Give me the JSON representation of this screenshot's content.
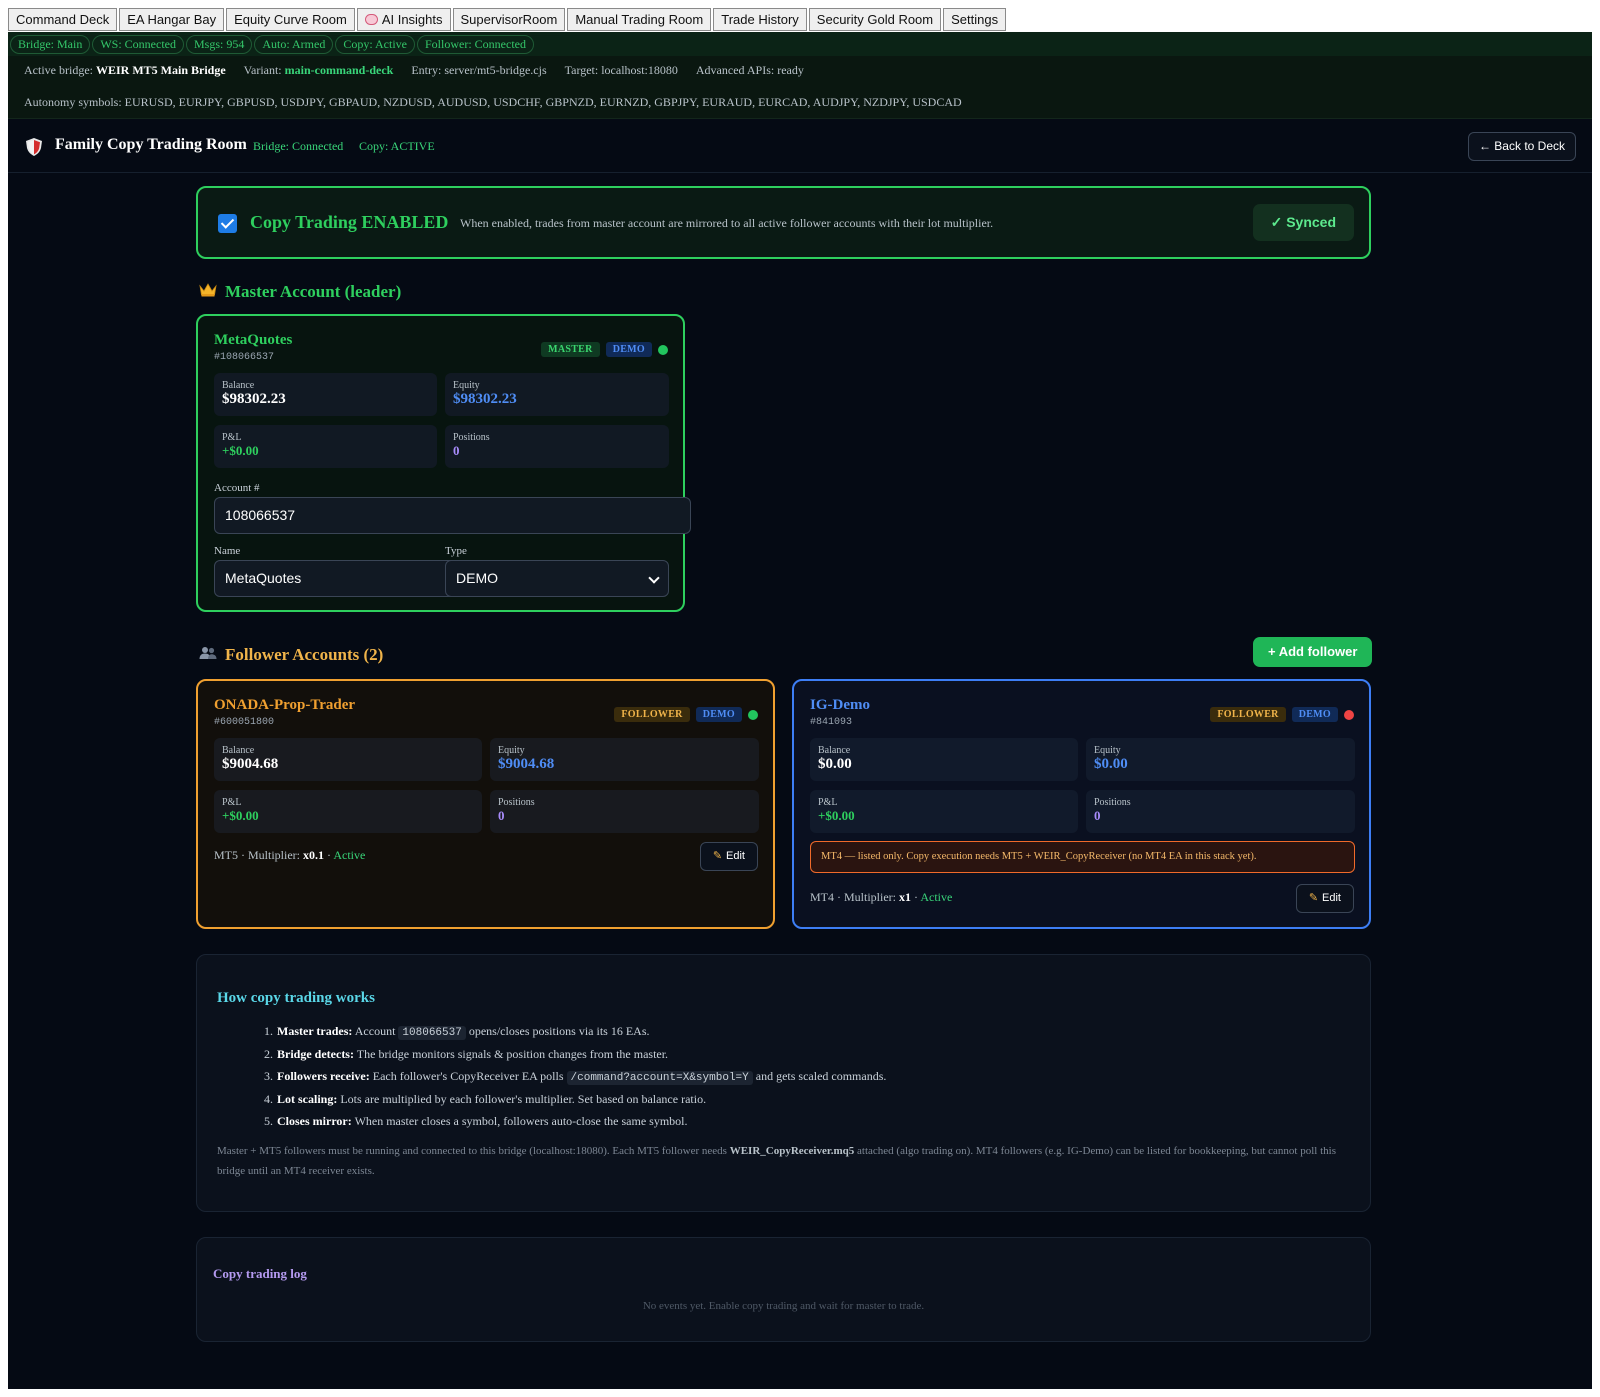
{
  "tabs": [
    {
      "label": "Command Deck"
    },
    {
      "label": "EA Hangar Bay"
    },
    {
      "label": "Equity Curve Room"
    },
    {
      "label": "AI Insights"
    },
    {
      "label": "SupervisorRoom"
    },
    {
      "label": "Manual Trading Room"
    },
    {
      "label": "Trade History"
    },
    {
      "label": "Security Gold Room"
    },
    {
      "label": "Settings"
    }
  ],
  "status_pills": [
    {
      "label": "Bridge: Main"
    },
    {
      "label": "WS: Connected"
    },
    {
      "label": "Msgs: 954"
    },
    {
      "label": "Auto: Armed"
    },
    {
      "label": "Copy: Active"
    },
    {
      "label": "Follower: Connected"
    }
  ],
  "info": {
    "bridge_label": "Active bridge:",
    "bridge_value": "WEIR MT5 Main Bridge",
    "variant_label": "Variant:",
    "variant_value": "main-command-deck",
    "entry": "Entry: server/mt5-bridge.cjs",
    "target": "Target: localhost:18080",
    "apis": "Advanced APIs: ready",
    "symbols": "Autonomy symbols: EURUSD, EURJPY, GBPUSD, USDJPY, GBPAUD, NZDUSD, AUDUSD, USDCHF, GBPNZD, EURNZD, GBPJPY, EURAUD, EURCAD, AUDJPY, NZDJPY, USDCAD"
  },
  "header": {
    "title": "Family Copy Trading Room",
    "bridge_status": "Bridge: Connected",
    "copy_status": "Copy: ACTIVE",
    "back_label": "← Back to Deck"
  },
  "banner": {
    "title": "Copy Trading ENABLED",
    "description": "When enabled, trades from master account are mirrored to all active follower accounts with their lot multiplier.",
    "synced_label": "✓ Synced"
  },
  "master_section": {
    "title": "Master Account (leader)",
    "icon": "crown-icon"
  },
  "master": {
    "name": "MetaQuotes",
    "number": "#108066537",
    "badge_role": "MASTER",
    "badge_type": "DEMO",
    "status_color": "#22c55e",
    "balance_label": "Balance",
    "balance": "$98302.23",
    "equity_label": "Equity",
    "equity": "$98302.23",
    "pnl_label": "P&L",
    "pnl": "+$0.00",
    "positions_label": "Positions",
    "positions": "0",
    "account_label": "Account #",
    "account_value": "108066537",
    "name_label": "Name",
    "name_value": "MetaQuotes",
    "type_label": "Type",
    "type_value": "DEMO"
  },
  "followers_section": {
    "title": "Follower Accounts (2)",
    "icon": "users-icon",
    "add_label": "+ Add follower"
  },
  "followers": [
    {
      "name": "ONADA-Prop-Trader",
      "number": "#600051800",
      "badge_role": "FOLLOWER",
      "badge_type": "DEMO",
      "status_color": "#22c55e",
      "balance_label": "Balance",
      "balance": "$9004.68",
      "equity_label": "Equity",
      "equity": "$9004.68",
      "pnl_label": "P&L",
      "pnl": "+$0.00",
      "positions_label": "Positions",
      "positions": "0",
      "platform": "MT5",
      "multiplier_label": "Multiplier:",
      "multiplier": "x0.1",
      "state": "Active",
      "edit_label": "Edit"
    },
    {
      "name": "IG-Demo",
      "number": "#841093",
      "badge_role": "FOLLOWER",
      "badge_type": "DEMO",
      "status_color": "#ef4444",
      "balance_label": "Balance",
      "balance": "$0.00",
      "equity_label": "Equity",
      "equity": "$0.00",
      "pnl_label": "P&L",
      "pnl": "+$0.00",
      "positions_label": "Positions",
      "positions": "0",
      "warning": "MT4 — listed only. Copy execution needs MT5 + WEIR_CopyReceiver (no MT4 EA in this stack yet).",
      "platform": "MT4",
      "multiplier_label": "Multiplier:",
      "multiplier": "x1",
      "state": "Active",
      "edit_label": "Edit"
    }
  ],
  "how": {
    "title": "How copy trading works",
    "steps": [
      {
        "num": "1.",
        "bold": "Master trades:",
        "pre": "Account",
        "code": "108066537",
        "post": "opens/closes positions via its 16 EAs."
      },
      {
        "num": "2.",
        "bold": "Bridge detects:",
        "text": "The bridge monitors signals & position changes from the master."
      },
      {
        "num": "3.",
        "bold": "Followers receive:",
        "pre": "Each follower's CopyReceiver EA polls",
        "code": "/command?account=X&symbol=Y",
        "post": "and gets scaled commands."
      },
      {
        "num": "4.",
        "bold": "Lot scaling:",
        "text": "Lots are multiplied by each follower's multiplier. Set based on balance ratio."
      },
      {
        "num": "5.",
        "bold": "Closes mirror:",
        "text": "When master closes a symbol, followers auto-close the same symbol."
      }
    ],
    "note_pre": "Master + MT5 followers must be running and connected to this bridge (localhost:18080). Each MT5 follower needs",
    "note_bold": "WEIR_CopyReceiver.mq5",
    "note_post": "attached (algo trading on). MT4 followers (e.g. IG-Demo) can be listed for bookkeeping, but cannot poll this bridge until an MT4 receiver exists."
  },
  "log": {
    "title": "Copy trading log",
    "empty": "No events yet. Enable copy trading and wait for master to trade."
  },
  "colors": {
    "accent_green": "#2ecf5e",
    "follower_orange": "#f0a030",
    "follower_blue": "#3d7ef5",
    "equity_blue": "#4f8df5",
    "positions_purple": "#a78bfa"
  }
}
